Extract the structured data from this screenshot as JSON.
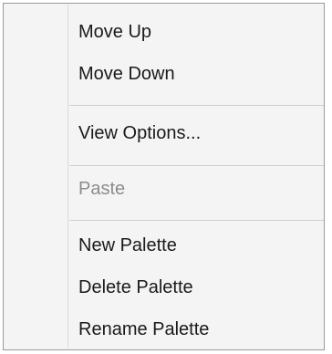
{
  "context_menu": {
    "items": [
      {
        "label": "Move Up",
        "enabled": true
      },
      {
        "label": "Move Down",
        "enabled": true
      },
      {
        "label": "View Options...",
        "enabled": true
      },
      {
        "label": "Paste",
        "enabled": false
      },
      {
        "label": "New Palette",
        "enabled": true
      },
      {
        "label": "Delete Palette",
        "enabled": true
      },
      {
        "label": "Rename Palette",
        "enabled": true
      }
    ]
  }
}
